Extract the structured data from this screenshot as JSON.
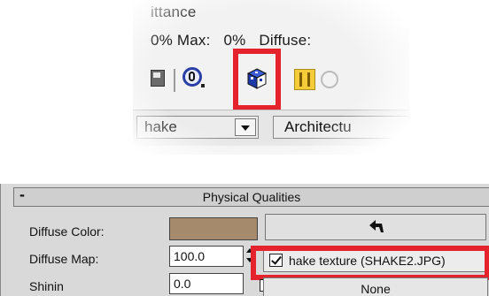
{
  "top_crop": {
    "line1": "ittance",
    "line2_a": "0% Max:",
    "line2_b": "0%",
    "line2_c": "Diffuse:",
    "toolbar_icons": [
      "save-icon",
      "material-id-icon",
      "material-cube-icon",
      "lights-icon",
      "ghost-icon"
    ],
    "combo_left": "hake",
    "combo_right": "Architectu"
  },
  "panel": {
    "title": "Physical Qualities",
    "collapse_symbol": "-",
    "diffuse_color_label": "Diffuse Color:",
    "diffuse_map_label": "Diffuse Map:",
    "shininess_label": "Shinin",
    "diffuse_map_amount": "100.0",
    "shininess_amount": "0.0",
    "map_button_label": "hake texture (SHAKE2.JPG)",
    "shininess_button_label": "None",
    "diffuse_color_hex": "#a68a6c"
  },
  "colors": {
    "highlight": "#e4232c"
  }
}
